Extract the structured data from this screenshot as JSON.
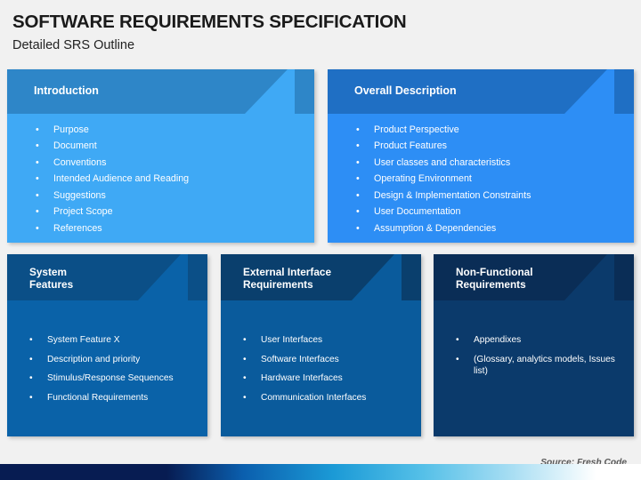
{
  "slide": {
    "title": "SOFTWARE REQUIREMENTS SPECIFICATION",
    "subtitle": "Detailed SRS Outline",
    "source": "Source: Fresh Code",
    "background_color": "#f1f1f1"
  },
  "cards": [
    {
      "title": "Introduction",
      "header_color": "#2e86c8",
      "body_color": "#3fa9f5",
      "bullet_glyph": "•",
      "bullets": [
        "Purpose",
        "Document",
        "Conventions",
        "Intended Audience and Reading",
        "Suggestions",
        "Project Scope",
        "References"
      ]
    },
    {
      "title": "Overall Description",
      "header_color": "#1f6fc4",
      "body_color": "#2d8ef5",
      "bullet_glyph": "•",
      "bullets": [
        "Product Perspective",
        "Product Features",
        "User classes and characteristics",
        "Operating Environment",
        "Design & Implementation Constraints",
        "User Documentation",
        "Assumption & Dependencies"
      ]
    },
    {
      "title": "System\nFeatures",
      "header_color": "#0b4f87",
      "body_color": "#0a62a8",
      "bullet_glyph": "•",
      "bullets": [
        "System Feature X",
        "Description and priority",
        "Stimulus/Response Sequences",
        "Functional Requirements"
      ]
    },
    {
      "title": "External Interface\nRequirements",
      "header_color": "#0a3f6d",
      "body_color": "#0a5b9c",
      "bullet_glyph": "•",
      "bullets": [
        "User Interfaces",
        "Software Interfaces",
        "Hardware Interfaces",
        "Communication Interfaces"
      ]
    },
    {
      "title": "Non-Functional\nRequirements",
      "header_color": "#0a2d56",
      "body_color": "#0b3a6b",
      "bullet_glyph": "•",
      "bullets": [
        "Appendixes",
        "(Glossary, analytics models, Issues list)"
      ]
    }
  ]
}
